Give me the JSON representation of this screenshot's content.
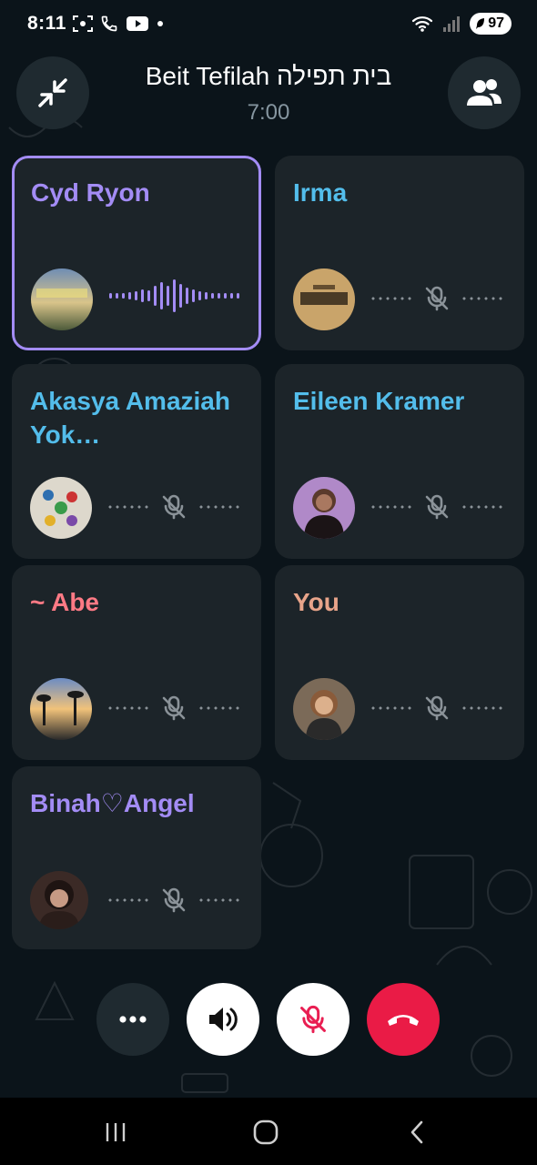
{
  "status_bar": {
    "time": "8:11",
    "battery": "97"
  },
  "call": {
    "title": "Beit Tefilah בית תפילה",
    "timer": "7:00"
  },
  "participants": [
    {
      "name": "Cyd Ryon",
      "color": "#a38cf5",
      "speaking": true,
      "muted": false
    },
    {
      "name": "Irma",
      "color": "#53bdeb",
      "speaking": false,
      "muted": true
    },
    {
      "name": "Akasya Amaziah Yok…",
      "color": "#53bdeb",
      "speaking": false,
      "muted": true
    },
    {
      "name": "Eileen Kramer",
      "color": "#53bdeb",
      "speaking": false,
      "muted": true
    },
    {
      "name": "~ Abe",
      "color": "#ff7a85",
      "speaking": false,
      "muted": true
    },
    {
      "name": "You",
      "color": "#e8a48a",
      "speaking": false,
      "muted": true
    },
    {
      "name": "Binah♡Angel",
      "color": "#a38cf5",
      "speaking": false,
      "muted": true
    }
  ],
  "colors": {
    "background": "#0b141a",
    "tile": "#1c2429",
    "active_border": "#a38cf5",
    "end_call": "#ea1b46"
  },
  "icons": {
    "minimize": "minimize-arrows-icon",
    "participants": "people-icon",
    "more": "more-horizontal-icon",
    "speaker": "speaker-icon",
    "mute": "mic-off-icon",
    "end": "phone-hangup-icon"
  }
}
